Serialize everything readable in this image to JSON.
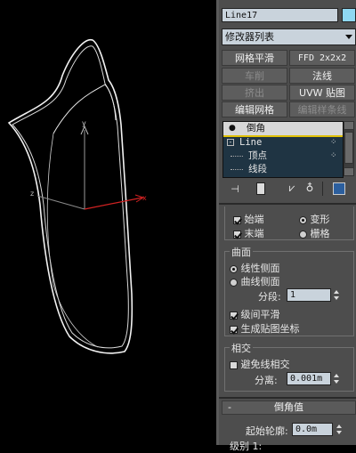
{
  "viewport": {
    "axis_labels": {
      "x": "x",
      "y": "y",
      "z": "z"
    }
  },
  "panel": {
    "object_name": "Line17",
    "object_color": "#8fd8f2",
    "modifier_list": "修改器列表",
    "buttons": [
      {
        "label": "网格平滑"
      },
      {
        "label": "FFD 2x2x2"
      },
      {
        "label": "车削"
      },
      {
        "label": "法线"
      },
      {
        "label": "挤出"
      },
      {
        "label": "UVW 贴图"
      },
      {
        "label": "编辑网格"
      },
      {
        "label": "编辑样条线"
      }
    ],
    "stack": {
      "items": [
        {
          "label": "倒角"
        },
        {
          "label": "Line"
        },
        {
          "label": "顶点"
        },
        {
          "label": "线段"
        }
      ]
    },
    "caps": {
      "start": "始端",
      "end": "末端",
      "morph": "变形",
      "grid": "栅格"
    },
    "surface": {
      "title": "曲面",
      "linear": "线性侧面",
      "curved": "曲线侧面",
      "segments_label": "分段:",
      "segments_value": "1",
      "smooth_across": "级间平滑",
      "gen_mapping": "生成贴图坐标"
    },
    "intersect": {
      "title": "相交",
      "keep_lines": "避免线相交",
      "separation_label": "分离:",
      "separation_value": "0.001m"
    },
    "bevel_values": {
      "title": "倒角值",
      "collapse": "-",
      "start_outline_label": "起始轮廓:",
      "start_outline_value": "0.0m",
      "level1_label": "级别 1:"
    }
  }
}
